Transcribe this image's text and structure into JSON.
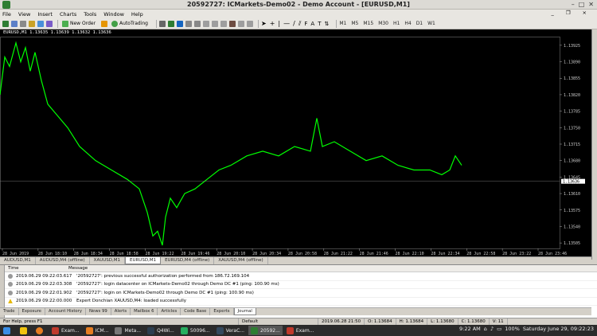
{
  "window": {
    "title": "20592727: ICMarkets-Demo02 - Demo Account - [EURUSD,M1]"
  },
  "menu": {
    "items": [
      "File",
      "View",
      "Insert",
      "Charts",
      "Tools",
      "Window",
      "Help"
    ]
  },
  "toolbar": {
    "new_order": "New Order",
    "autotrading": "AutoTrading",
    "timeframes": [
      "M1",
      "M5",
      "M15",
      "M30",
      "H1",
      "H4",
      "D1",
      "W1"
    ]
  },
  "chart": {
    "symbol_line": "EURUSD,M1  1.13635 1.13639 1.13632 1.13636",
    "current_price": "1.13636",
    "price_ticks": [
      "1.13925",
      "1.13890",
      "1.13855",
      "1.13820",
      "1.13785",
      "1.13750",
      "1.13715",
      "1.13680",
      "1.13645",
      "1.13610",
      "1.13575",
      "1.13540",
      "1.13505"
    ],
    "time_ticks": [
      "28 Jun 2019",
      "28 Jun 18:10",
      "28 Jun 18:34",
      "28 Jun 18:58",
      "28 Jun 19:22",
      "28 Jun 19:46",
      "28 Jun 20:10",
      "28 Jun 20:34",
      "28 Jun 20:58",
      "28 Jun 21:22",
      "28 Jun 21:46",
      "28 Jun 22:10",
      "28 Jun 22:34",
      "28 Jun 22:58",
      "28 Jun 23:22",
      "28 Jun 23:46"
    ],
    "price_range": [
      1.1349,
      1.1394
    ],
    "bar_color": "#00ff00",
    "background": "#000000"
  },
  "chart_tabs": [
    {
      "label": "AUDUSD,M1",
      "active": false
    },
    {
      "label": "AUDUSD,M4 (offline)",
      "active": false
    },
    {
      "label": "XAUUSD,M1",
      "active": false
    },
    {
      "label": "EURUSD,M1",
      "active": true
    },
    {
      "label": "EURUSD,M4 (offline)",
      "active": false
    },
    {
      "label": "XAUUSD,M4 (offline)",
      "active": false
    }
  ],
  "terminal": {
    "columns": [
      "Time",
      "Message"
    ],
    "rows": [
      {
        "time": "2019.06.29 09:22:03.617",
        "message": "'20592727': previous successful authorization performed from 186.72.169.104",
        "icon": "info"
      },
      {
        "time": "2019.06.29 09:22:03.308",
        "message": "'20592727': login datacenter on ICMarkets-Demo02 through Demo DC #1 (ping: 100.90 ms)",
        "icon": "info"
      },
      {
        "time": "2019.06.29 09:22:01.902",
        "message": "'20592727': login on ICMarkets-Demo02 through Demo DC #1 (ping: 100.90 ms)",
        "icon": "info"
      },
      {
        "time": "2019.06.29 09:22:00.000",
        "message": "Expert Donchian XAUUSD,M4: loaded successfully",
        "icon": "warning"
      }
    ],
    "tabs": [
      "Trade",
      "Exposure",
      "Account History",
      "News 99",
      "Alerts",
      "Mailbox 6",
      "Articles",
      "Code Base",
      "Experts",
      "Journal"
    ],
    "active_tab": "Journal"
  },
  "status": {
    "help": "For Help, press F1",
    "profile": "Default",
    "datetime": "2019.06.28 21:50",
    "open": "O: 1.13684",
    "high": "H: 1.13684",
    "low": "L: 1.13680",
    "close": "C: 1.13680",
    "volume": "V: 11"
  },
  "taskbar": {
    "tasks": [
      {
        "label": "Exam...",
        "color": "#c0392b"
      },
      {
        "label": "ICM...",
        "color": "#e67e22"
      },
      {
        "label": "Meta...",
        "color": "#777"
      },
      {
        "label": "Q4Wi...",
        "color": "#2c3e50"
      },
      {
        "label": "50096...",
        "color": "#27ae60"
      },
      {
        "label": "VeraC...",
        "color": "#34495e"
      },
      {
        "label": "20592...",
        "color": "#2e7d32"
      },
      {
        "label": "Exam...",
        "color": "#c0392b"
      }
    ],
    "clock": "9:22 AM",
    "battery": "100%",
    "date": "Saturday June 29, 09:22:23"
  },
  "colors": {
    "chrome": "#d4d0c8",
    "taskbar": "#2b2b2b",
    "accent": "#00ff00"
  }
}
